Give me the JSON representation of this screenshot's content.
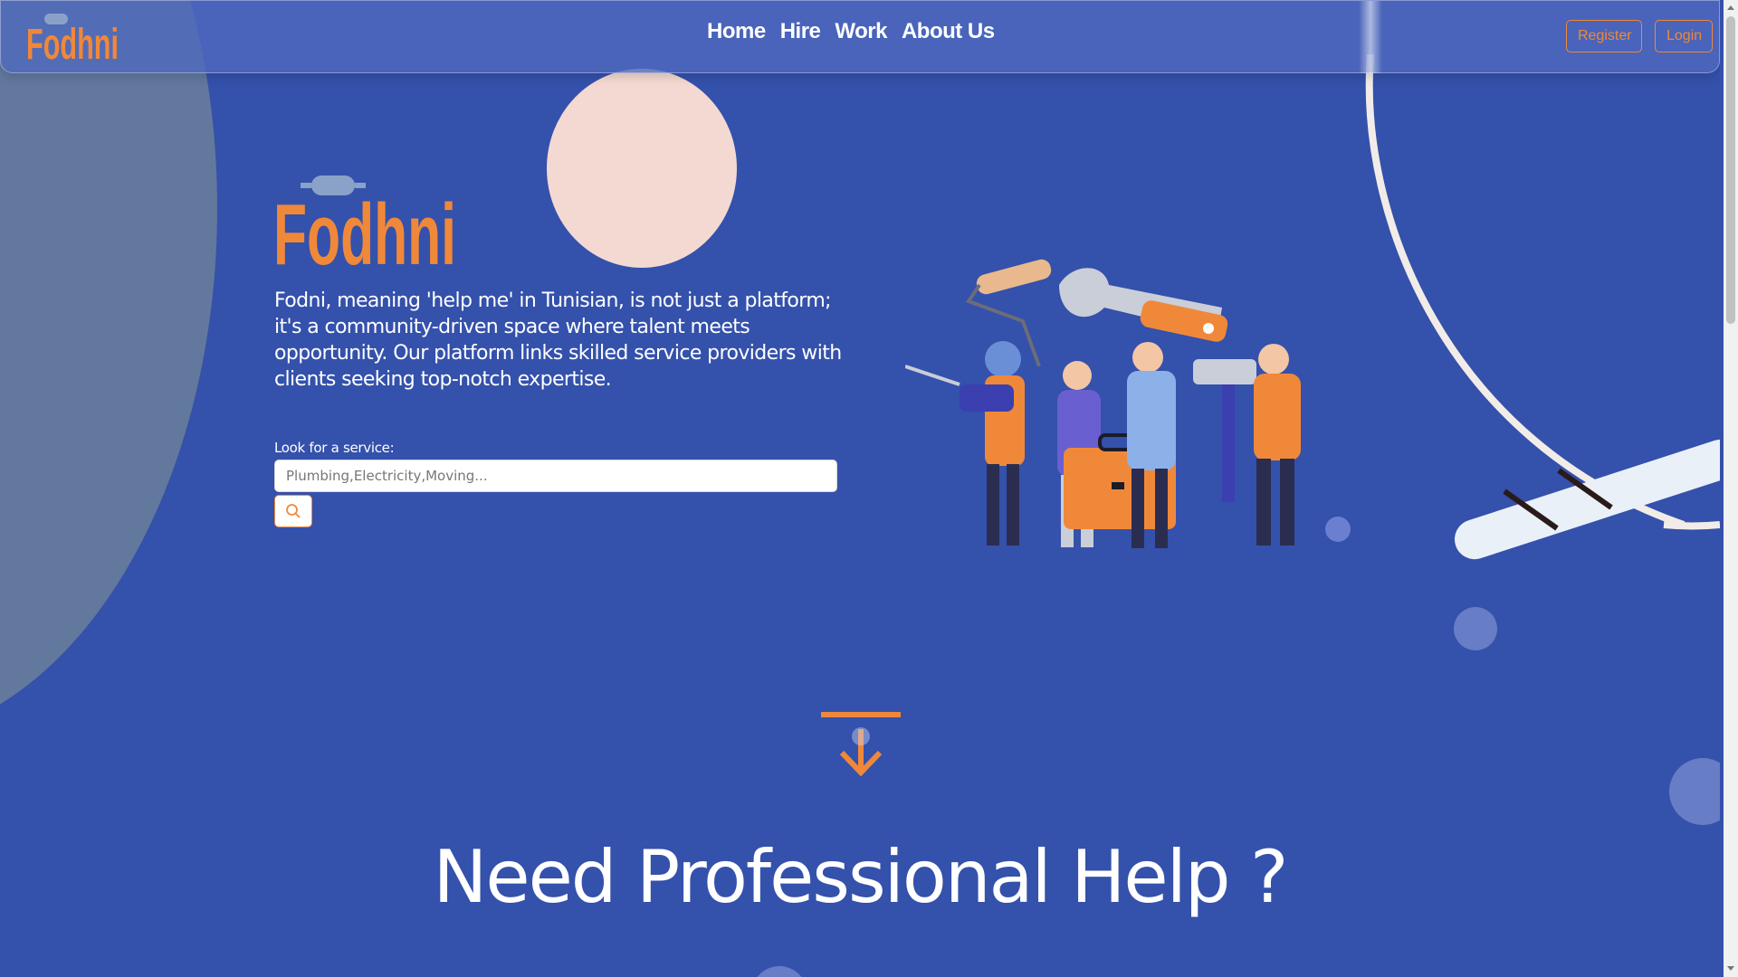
{
  "nav": {
    "logo_text": "Fodhni",
    "links": [
      "Home",
      "Hire",
      "Work",
      "About Us"
    ],
    "register_label": "Register",
    "login_label": "Login"
  },
  "hero": {
    "logo_text": "Fodhni",
    "description": "Fodni, meaning 'help me' in Tunisian, is not just a platform; it's a community-driven space where talent meets opportunity. Our platform links skilled service providers with clients seeking top-notch expertise.",
    "search_label": "Look for a service:",
    "search_placeholder": "Plumbing,Electricity,Moving...",
    "search_value": "",
    "search_icon": "search-icon"
  },
  "section": {
    "heading": "Need Professional Help ?",
    "arrow_icon": "arrow-down-to-line-icon"
  },
  "colors": {
    "background": "#3451ab",
    "accent": "#f0883a",
    "pink": "#f4d9d2"
  }
}
